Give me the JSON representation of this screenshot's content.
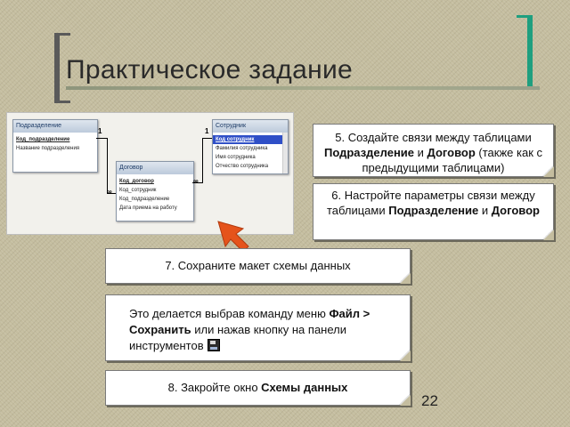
{
  "slide": {
    "title": "Практическое задание",
    "page_number": "22"
  },
  "schema": {
    "tables": [
      {
        "name": "Подразделение",
        "fields": [
          "Код_подразделение",
          "Название подразделения"
        ]
      },
      {
        "name": "Договор",
        "fields": [
          "Код_договор",
          "Код_сотрудник",
          "Код_подразделение",
          "Дата приема на работу"
        ]
      },
      {
        "name": "Сотрудник",
        "fields": [
          "Код сотрудник",
          "Фамилия сотрудника",
          "Имя сотрудника",
          "Отчество сотрудника"
        ]
      }
    ],
    "relation_labels": {
      "one_left": "1",
      "many_left": "∞",
      "one_right": "1",
      "many_right": "∞"
    }
  },
  "notes": {
    "n5": {
      "pre": "5. Создайте связи между таблицами ",
      "b1": "Подразделение",
      "mid": " и ",
      "b2": "Договор",
      "post": " (также как с предыдущими таблицами)"
    },
    "n6": {
      "pre": "6. Настройте параметры связи между таблицами ",
      "b1": "Подразделение",
      "mid": " и ",
      "b2": "Договор"
    },
    "n7": {
      "text": "7. Сохраните макет схемы данных"
    },
    "howto": {
      "pre": "Это делается выбрав команду меню ",
      "b1": "Файл > Сохранить",
      "post": " или нажав кнопку на панели инструментов"
    },
    "n8": {
      "pre": "8. Закройте окно ",
      "b1": "Схемы данных"
    }
  },
  "colors": {
    "accent_bracket": "#1f9f7f",
    "arrow": "#e5531b"
  }
}
